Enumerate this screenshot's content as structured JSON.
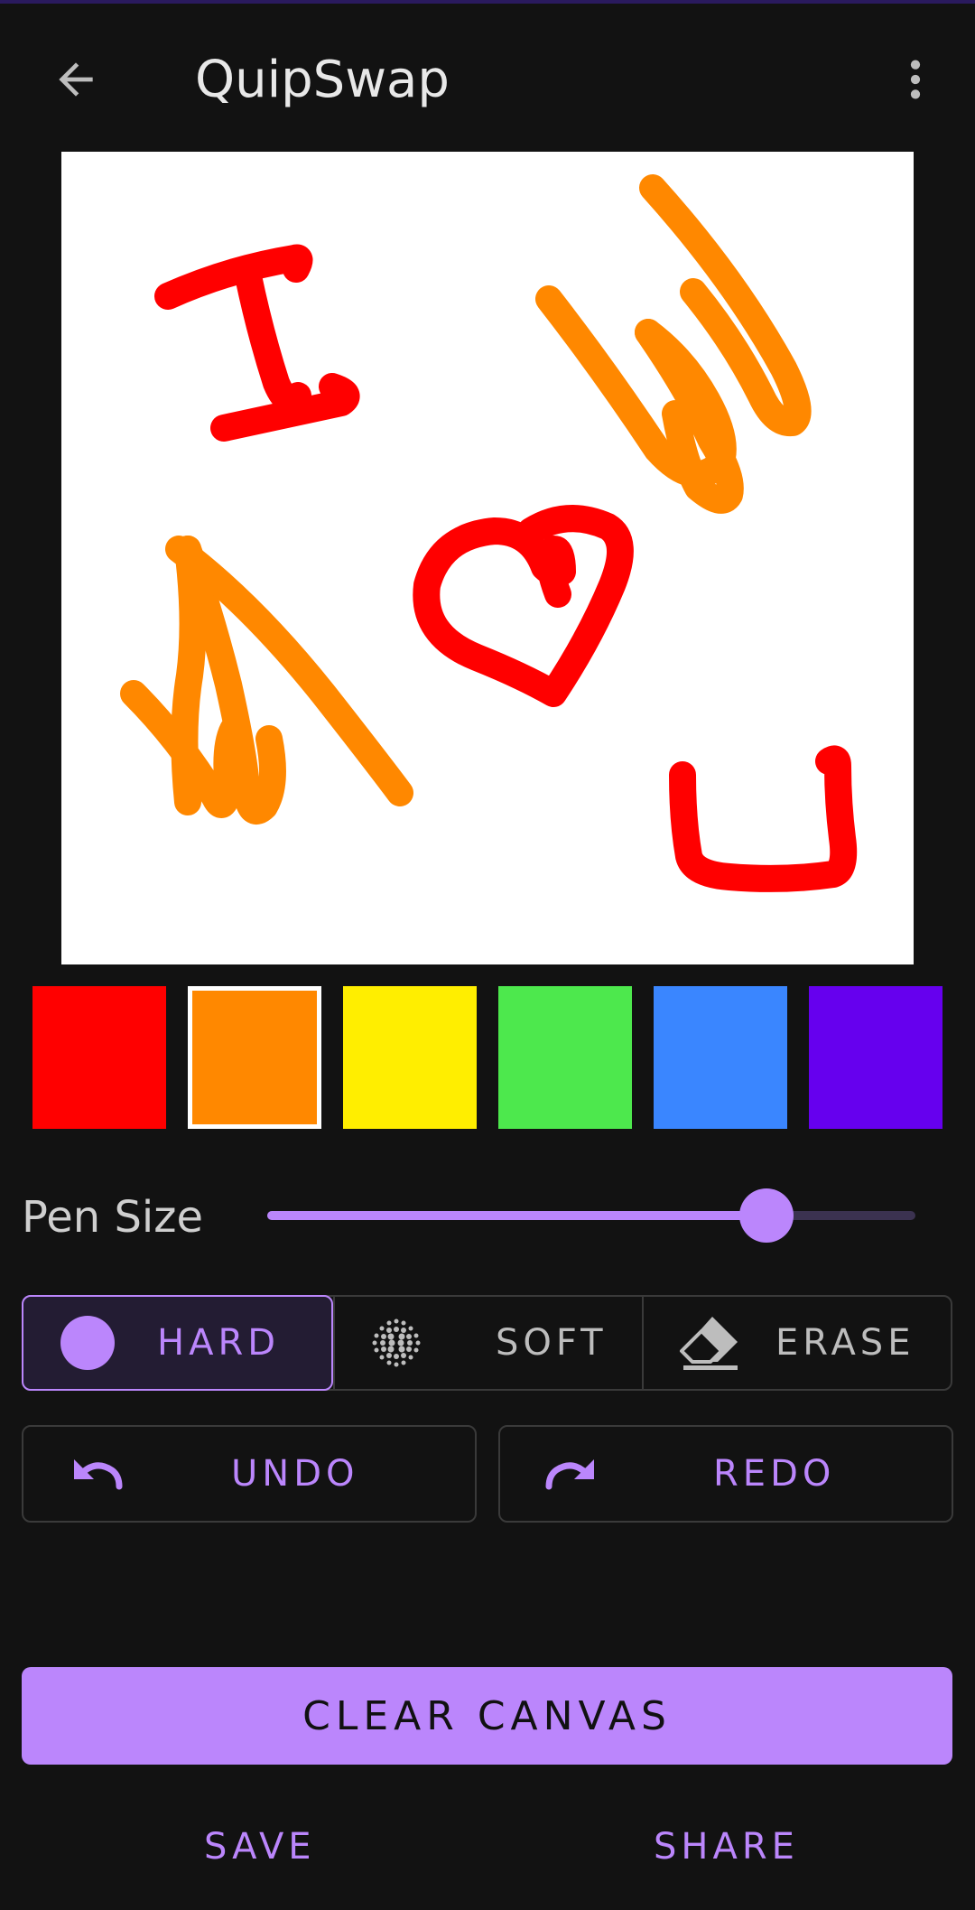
{
  "app_bar": {
    "title": "QuipSwap",
    "back_icon": "arrow-left-icon",
    "menu_icon": "more-vertical-icon"
  },
  "canvas": {
    "background": "#ffffff",
    "strokes": [
      {
        "color": "#ff0000",
        "description": "letter I"
      },
      {
        "color": "#ff8800",
        "description": "letter W"
      },
      {
        "color": "#ff0000",
        "description": "heart"
      },
      {
        "color": "#ff8800",
        "description": "letter N"
      },
      {
        "color": "#ff0000",
        "description": "letter U"
      }
    ]
  },
  "palette": {
    "colors": [
      "#ff0000",
      "#ff8800",
      "#ffee00",
      "#4de84d",
      "#3a86ff",
      "#6600ee"
    ],
    "selected_index": 1
  },
  "pen_size": {
    "label": "Pen Size",
    "value_fraction": 0.77
  },
  "brush_modes": [
    {
      "label": "HARD",
      "icon": "circle-icon",
      "active": true
    },
    {
      "label": "SOFT",
      "icon": "dotted-circle-icon",
      "active": false
    },
    {
      "label": "ERASE",
      "icon": "eraser-icon",
      "active": false
    }
  ],
  "actions": {
    "undo_label": "UNDO",
    "redo_label": "REDO"
  },
  "clear_label": "CLEAR CANVAS",
  "bottom": {
    "save_label": "SAVE",
    "share_label": "SHARE"
  },
  "theme": {
    "accent": "#bb86fc",
    "background": "#121212"
  }
}
